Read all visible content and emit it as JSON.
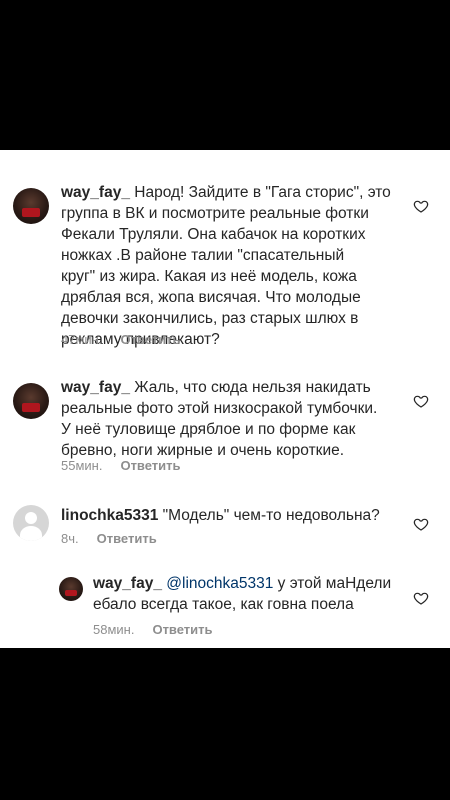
{
  "comments": [
    {
      "username": "way_fay_",
      "text": " Народ! Зайдите в \"Гага сторис\", это\nгруппа в ВК и посмотрите реальные фотки\nФекали Труляли. Она кабачок на коротких\nножках .В районе талии \"спасательный\nкруг\" из жира. Какая из неё модель, кожа\nдряблая вся, жопа висячая. Что молодые\nдевочки закончились, раз старых шлюх в\nрекламу привлекают?",
      "time": "47мин.",
      "reply": "Ответить",
      "avatar": "masked-avatar"
    },
    {
      "username": "way_fay_",
      "text": " Жаль, что сюда нельзя накидать\nреальные фото этой низкосракой тумбочки.\nУ неё туловище дряблое и по форме как\nбревно, ноги жирные и очень короткие.",
      "time": "55мин.",
      "reply": "Ответить",
      "avatar": "masked-avatar"
    },
    {
      "username": "linochka5331",
      "text": " \"Модель\" чем-то недовольна?",
      "time": "8ч.",
      "reply": "Ответить",
      "avatar": "default-avatar"
    },
    {
      "username": "way_fay_",
      "mention": " @linochka5331",
      "text_line1": " у этой маНдели",
      "text_line2": "ебало всегда такое, как говна поела",
      "time": "58мин.",
      "reply": "Ответить",
      "avatar": "masked-avatar"
    }
  ],
  "icons": {
    "like": "heart-outline-icon"
  },
  "colors": {
    "text": "#262626",
    "meta": "#8e8e8e",
    "mention": "#003569",
    "background": "#000000",
    "panel": "#ffffff"
  }
}
